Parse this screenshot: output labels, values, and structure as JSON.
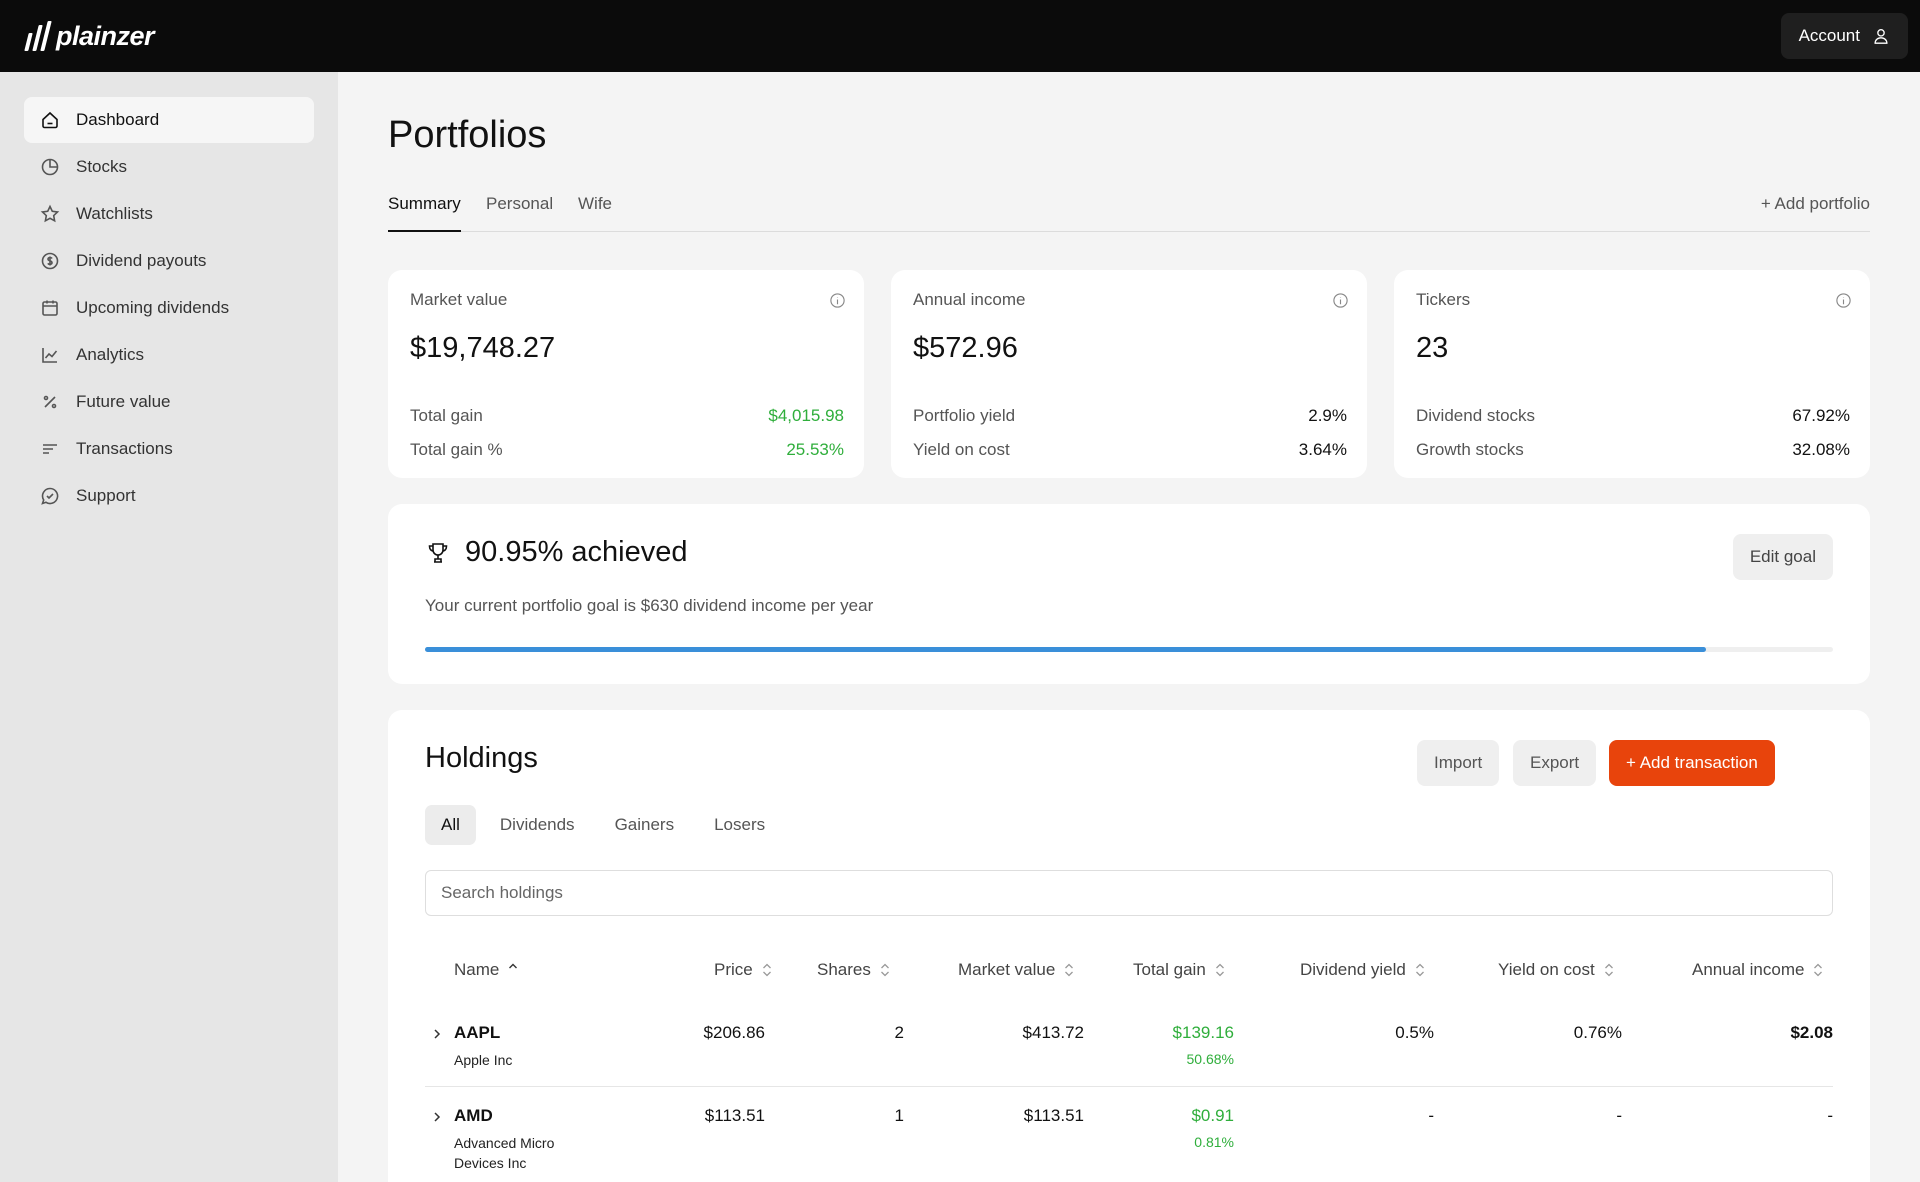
{
  "brand": {
    "name": "plainzer"
  },
  "account": {
    "label": "Account"
  },
  "sidebar": {
    "items": [
      {
        "label": "Dashboard",
        "icon": "home-icon",
        "active": true
      },
      {
        "label": "Stocks",
        "icon": "pie-chart-icon"
      },
      {
        "label": "Watchlists",
        "icon": "star-icon"
      },
      {
        "label": "Dividend payouts",
        "icon": "dollar-circle-icon"
      },
      {
        "label": "Upcoming dividends",
        "icon": "calendar-icon"
      },
      {
        "label": "Analytics",
        "icon": "line-chart-icon"
      },
      {
        "label": "Future value",
        "icon": "percent-icon"
      },
      {
        "label": "Transactions",
        "icon": "lines-icon"
      },
      {
        "label": "Support",
        "icon": "chat-check-icon"
      }
    ]
  },
  "page": {
    "title": "Portfolios"
  },
  "tabs": [
    {
      "label": "Summary",
      "active": true
    },
    {
      "label": "Personal"
    },
    {
      "label": "Wife"
    }
  ],
  "add_portfolio_label": "+ Add portfolio",
  "stats": {
    "market_value": {
      "label": "Market value",
      "value": "$19,748.27",
      "row1_label": "Total gain",
      "row1_value": "$4,015.98",
      "row2_label": "Total gain %",
      "row2_value": "25.53%"
    },
    "annual_income": {
      "label": "Annual income",
      "value": "$572.96",
      "row1_label": "Portfolio yield",
      "row1_value": "2.9%",
      "row2_label": "Yield on cost",
      "row2_value": "3.64%"
    },
    "tickers": {
      "label": "Tickers",
      "value": "23",
      "row1_label": "Dividend stocks",
      "row1_value": "67.92%",
      "row2_label": "Growth stocks",
      "row2_value": "32.08%"
    }
  },
  "goal": {
    "title": "90.95% achieved",
    "subtitle": "Your current portfolio goal is $630 dividend income per year",
    "edit_label": "Edit goal",
    "progress_fraction": 0.9095,
    "progress_color": "#3a8fd9"
  },
  "holdings": {
    "title": "Holdings",
    "import_label": "Import",
    "export_label": "Export",
    "add_label": "+ Add transaction",
    "accent": "#e8440c",
    "filters": [
      "All",
      "Dividends",
      "Gainers",
      "Losers"
    ],
    "search_placeholder": "Search holdings",
    "columns": [
      "Name",
      "Price",
      "Shares",
      "Market value",
      "Total gain",
      "Dividend yield",
      "Yield on cost",
      "Annual income"
    ],
    "rows": [
      {
        "ticker": "AAPL",
        "company": "Apple Inc",
        "price": "$206.86",
        "shares": "2",
        "market_value": "$413.72",
        "total_gain": "$139.16",
        "total_gain_pct": "50.68%",
        "dividend_yield": "0.5%",
        "yield_on_cost": "0.76%",
        "annual_income": "$2.08"
      },
      {
        "ticker": "AMD",
        "company": "Advanced Micro Devices Inc",
        "price": "$113.51",
        "shares": "1",
        "market_value": "$113.51",
        "total_gain": "$0.91",
        "total_gain_pct": "0.81%",
        "dividend_yield": "-",
        "yield_on_cost": "-",
        "annual_income": "-"
      }
    ]
  }
}
